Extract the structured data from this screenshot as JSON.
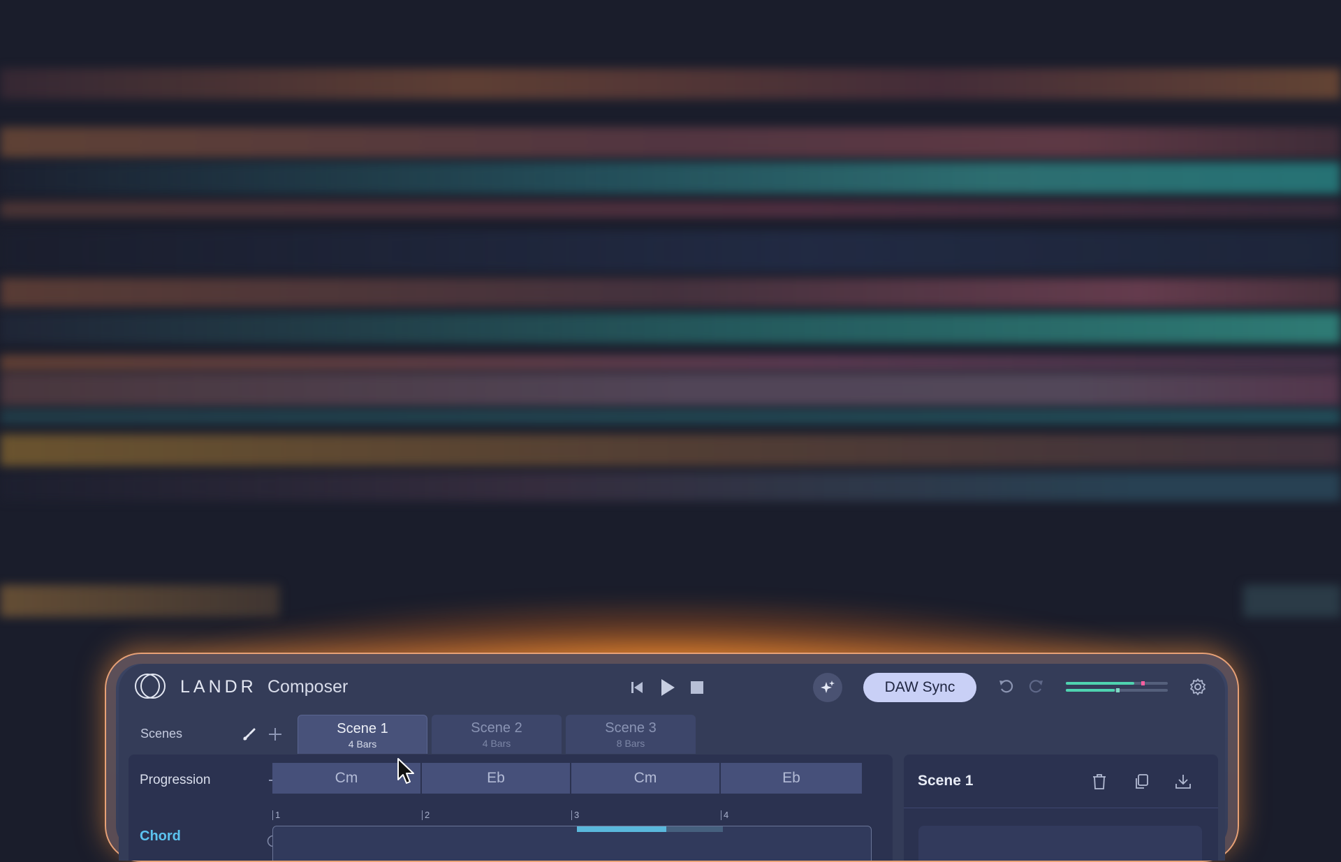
{
  "app": {
    "brand": "LANDR",
    "product": "Composer",
    "daw_sync_label": "DAW Sync"
  },
  "scenes": {
    "label": "Scenes",
    "tabs": [
      {
        "name": "Scene 1",
        "bars": "4 Bars",
        "active": true
      },
      {
        "name": "Scene 2",
        "bars": "4 Bars",
        "active": false
      },
      {
        "name": "Scene 3",
        "bars": "8 Bars",
        "active": false
      }
    ]
  },
  "progression": {
    "label": "Progression",
    "chords": [
      "Cm",
      "Eb",
      "Cm",
      "Eb"
    ]
  },
  "timeline": {
    "bars": [
      "1",
      "2",
      "3",
      "4"
    ]
  },
  "tracks": [
    {
      "label": "Chord"
    }
  ],
  "side_panel": {
    "title": "Scene 1"
  },
  "meters": [
    {
      "level": 0.67,
      "peak": 0.74
    },
    {
      "level": 0.48,
      "peak": 0.49
    }
  ],
  "colors": {
    "accent_teal": "#4fd3b0",
    "accent_blue": "#5ab8dc",
    "daw_button": "#c9d0f6",
    "window_glow": "#ff8c1e",
    "peak_pink": "#ff5fa0"
  },
  "icons": {
    "logo": "landr-logo-icon",
    "transport": [
      "skip-back-icon",
      "play-icon",
      "stop-icon"
    ],
    "ai": "sparkle-icon",
    "undo": "undo-icon",
    "redo": "redo-icon",
    "settings": "gear-icon"
  }
}
